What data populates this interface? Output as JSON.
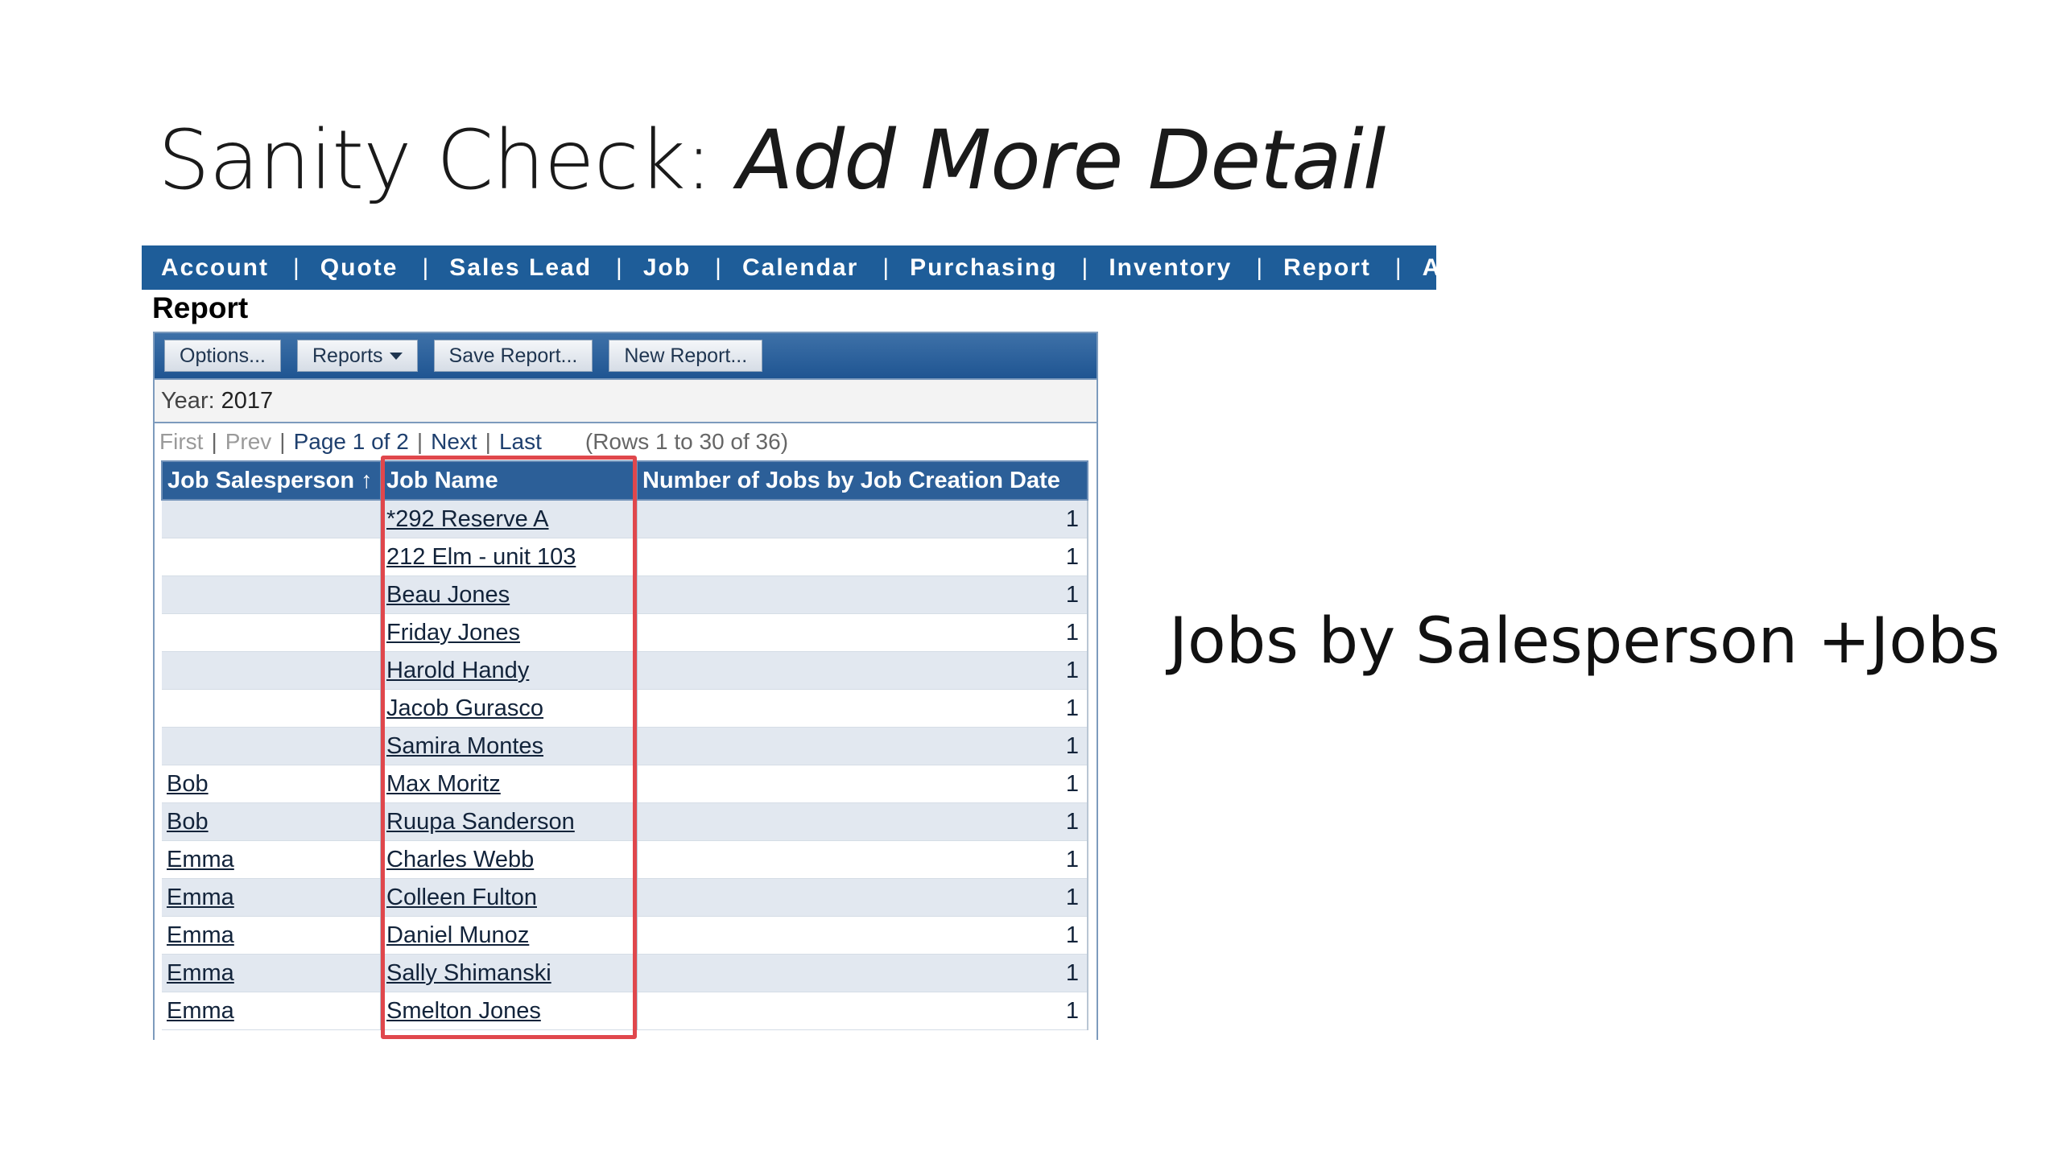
{
  "slide": {
    "title_plain": "Sanity Check: ",
    "title_italic": "Add More Detail",
    "side_note": "Jobs by Salesperson +Jobs"
  },
  "nav": {
    "items": [
      "Account",
      "Quote",
      "Sales Lead",
      "Job",
      "Calendar",
      "Purchasing",
      "Inventory",
      "Report",
      "Ad"
    ],
    "separator": "|"
  },
  "report": {
    "heading": "Report",
    "toolbar": {
      "options_label": "Options...",
      "reports_label": "Reports",
      "save_label": "Save Report...",
      "new_label": "New Report..."
    },
    "filter": {
      "label": "Year:",
      "value": "2017"
    },
    "pager": {
      "first": "First",
      "prev": "Prev",
      "page_text": "Page 1 of 2",
      "next": "Next",
      "last": "Last",
      "rows_text": "(Rows 1 to 30 of 36)"
    },
    "columns": [
      "Job Salesperson ↑",
      "Job Name",
      "Number of Jobs by Job Creation Date"
    ],
    "rows": [
      {
        "salesperson": "",
        "job": "*292 Reserve A",
        "count": "1"
      },
      {
        "salesperson": "",
        "job": "212 Elm - unit 103",
        "count": "1"
      },
      {
        "salesperson": "",
        "job": "Beau Jones",
        "count": "1"
      },
      {
        "salesperson": "",
        "job": "Friday Jones",
        "count": "1"
      },
      {
        "salesperson": "",
        "job": "Harold Handy",
        "count": "1"
      },
      {
        "salesperson": "",
        "job": "Jacob Gurasco",
        "count": "1"
      },
      {
        "salesperson": "",
        "job": "Samira Montes",
        "count": "1"
      },
      {
        "salesperson": "Bob",
        "job": "Max Moritz",
        "count": "1"
      },
      {
        "salesperson": "Bob",
        "job": "Ruupa Sanderson",
        "count": "1"
      },
      {
        "salesperson": "Emma",
        "job": "Charles Webb",
        "count": "1"
      },
      {
        "salesperson": "Emma",
        "job": "Colleen Fulton",
        "count": "1"
      },
      {
        "salesperson": "Emma",
        "job": "Daniel Munoz",
        "count": "1"
      },
      {
        "salesperson": "Emma",
        "job": "Sally Shimanski",
        "count": "1"
      },
      {
        "salesperson": "Emma",
        "job": "Smelton Jones",
        "count": "1"
      }
    ]
  },
  "colors": {
    "nav_bg": "#1e5d99",
    "header_bg": "#2c5f98",
    "highlight": "#e0474c"
  }
}
